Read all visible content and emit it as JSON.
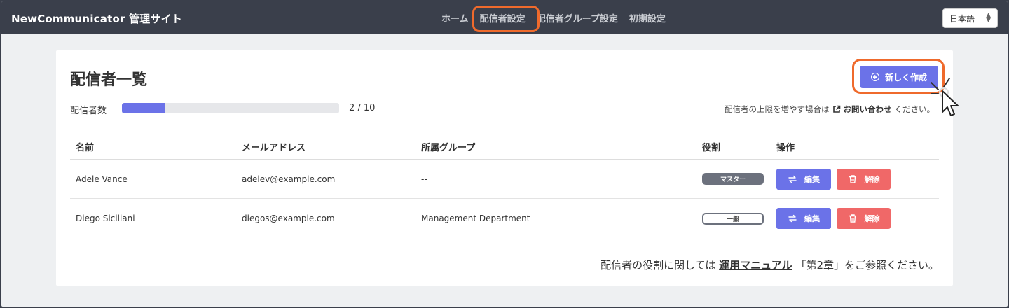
{
  "header": {
    "brand": "NewCommunicator 管理サイト",
    "nav": [
      {
        "label": "ホーム"
      },
      {
        "label": "配信者設定"
      },
      {
        "label": "配信者グループ設定"
      },
      {
        "label": "初期設定"
      }
    ],
    "language": "日本語"
  },
  "main": {
    "title": "配信者一覧",
    "new_button": "新しく作成",
    "count_label": "配信者数",
    "count_text": "2 / 10",
    "progress_fraction": 0.2,
    "limit_note_prefix": "配信者の上限を増やす場合は",
    "limit_note_link": "お問い合わせ",
    "limit_note_suffix": "ください。",
    "table": {
      "headers": [
        "名前",
        "メールアドレス",
        "所属グループ",
        "役割",
        "操作"
      ],
      "rows": [
        {
          "name": "Adele Vance",
          "email": "adelev@example.com",
          "group": "--",
          "role": "マスター",
          "role_type": "master"
        },
        {
          "name": "Diego Siciliani",
          "email": "diegos@example.com",
          "group": "Management Department",
          "role": "一般",
          "role_type": "general"
        }
      ],
      "edit_label": "編集",
      "delete_label": "解除"
    },
    "footer_prefix": "配信者の役割に関しては",
    "footer_link": "運用マニュアル",
    "footer_suffix": "「第2章」をご参照ください。"
  },
  "colors": {
    "accent": "#6b72e8",
    "danger": "#f06868",
    "highlight": "#ef6a2c",
    "header_bg": "#3a3f4b"
  }
}
